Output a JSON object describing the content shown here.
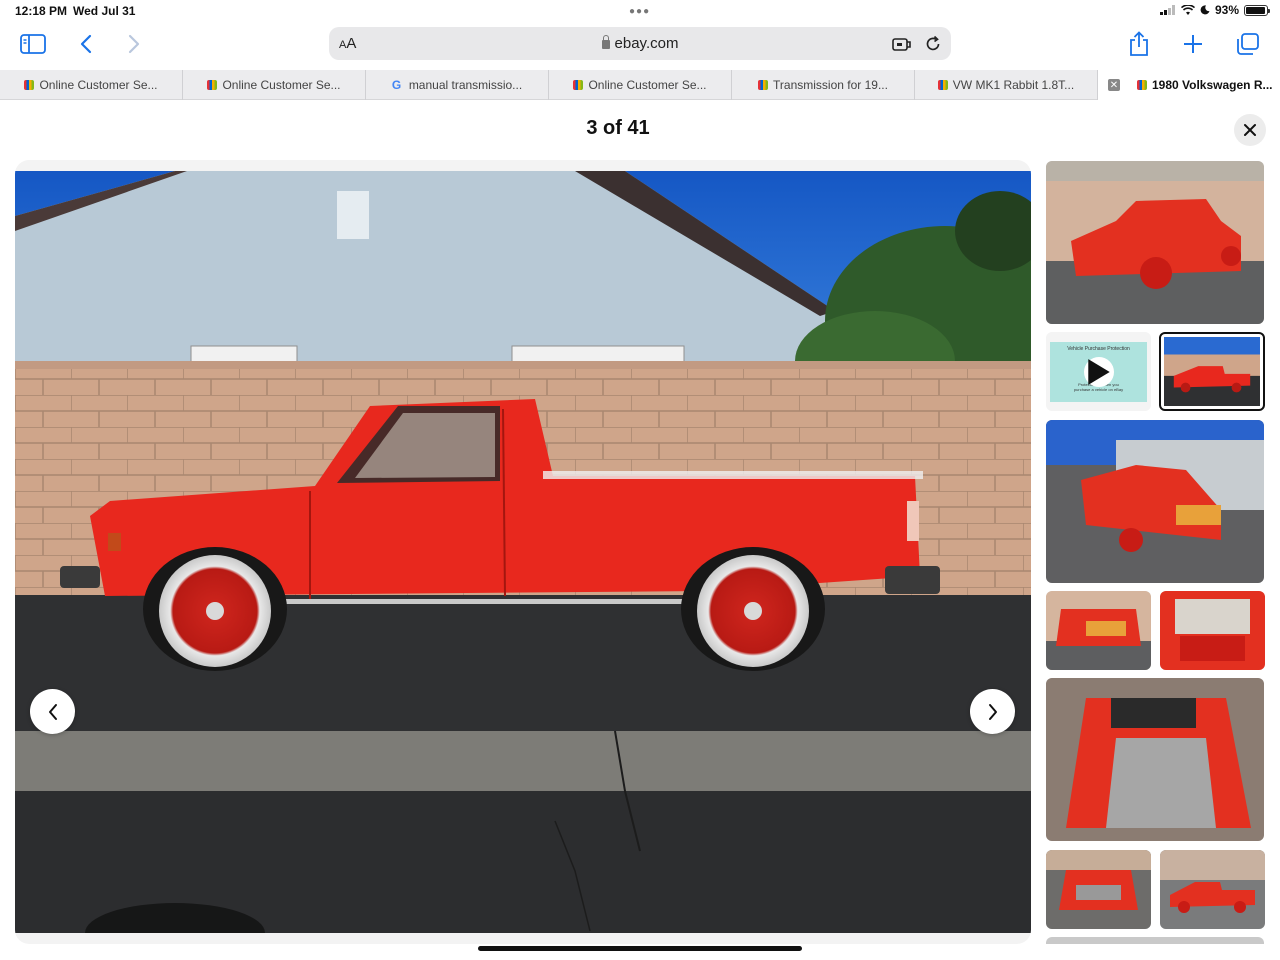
{
  "status": {
    "time": "12:18 PM",
    "date": "Wed Jul 31",
    "battery": "93%",
    "battery_level": 0.93
  },
  "toolbar": {
    "aa_label_small": "A",
    "aa_label_big": "A",
    "url": "ebay.com"
  },
  "tabs": [
    {
      "label": "Online Customer Se...",
      "favicon": "ebay"
    },
    {
      "label": "Online Customer Se...",
      "favicon": "ebay"
    },
    {
      "label": "manual transmissio...",
      "favicon": "google"
    },
    {
      "label": "Online Customer Se...",
      "favicon": "ebay"
    },
    {
      "label": "Transmission for 19...",
      "favicon": "ebay"
    },
    {
      "label": "VW MK1 Rabbit 1.8T...",
      "favicon": "ebay"
    },
    {
      "label": "1980 Volkswagen R...",
      "favicon": "ebay",
      "active": true
    }
  ],
  "viewer": {
    "counter": "3 of 41",
    "video_title": "Vehicle Purchase Protection",
    "video_caption_line1": "Protection ... when you",
    "video_caption_line2": "purchase a vehicle on eBay"
  },
  "colors": {
    "accent": "#1a73e8",
    "car_red": "#e8281e",
    "sky": "#1e5fc8"
  }
}
